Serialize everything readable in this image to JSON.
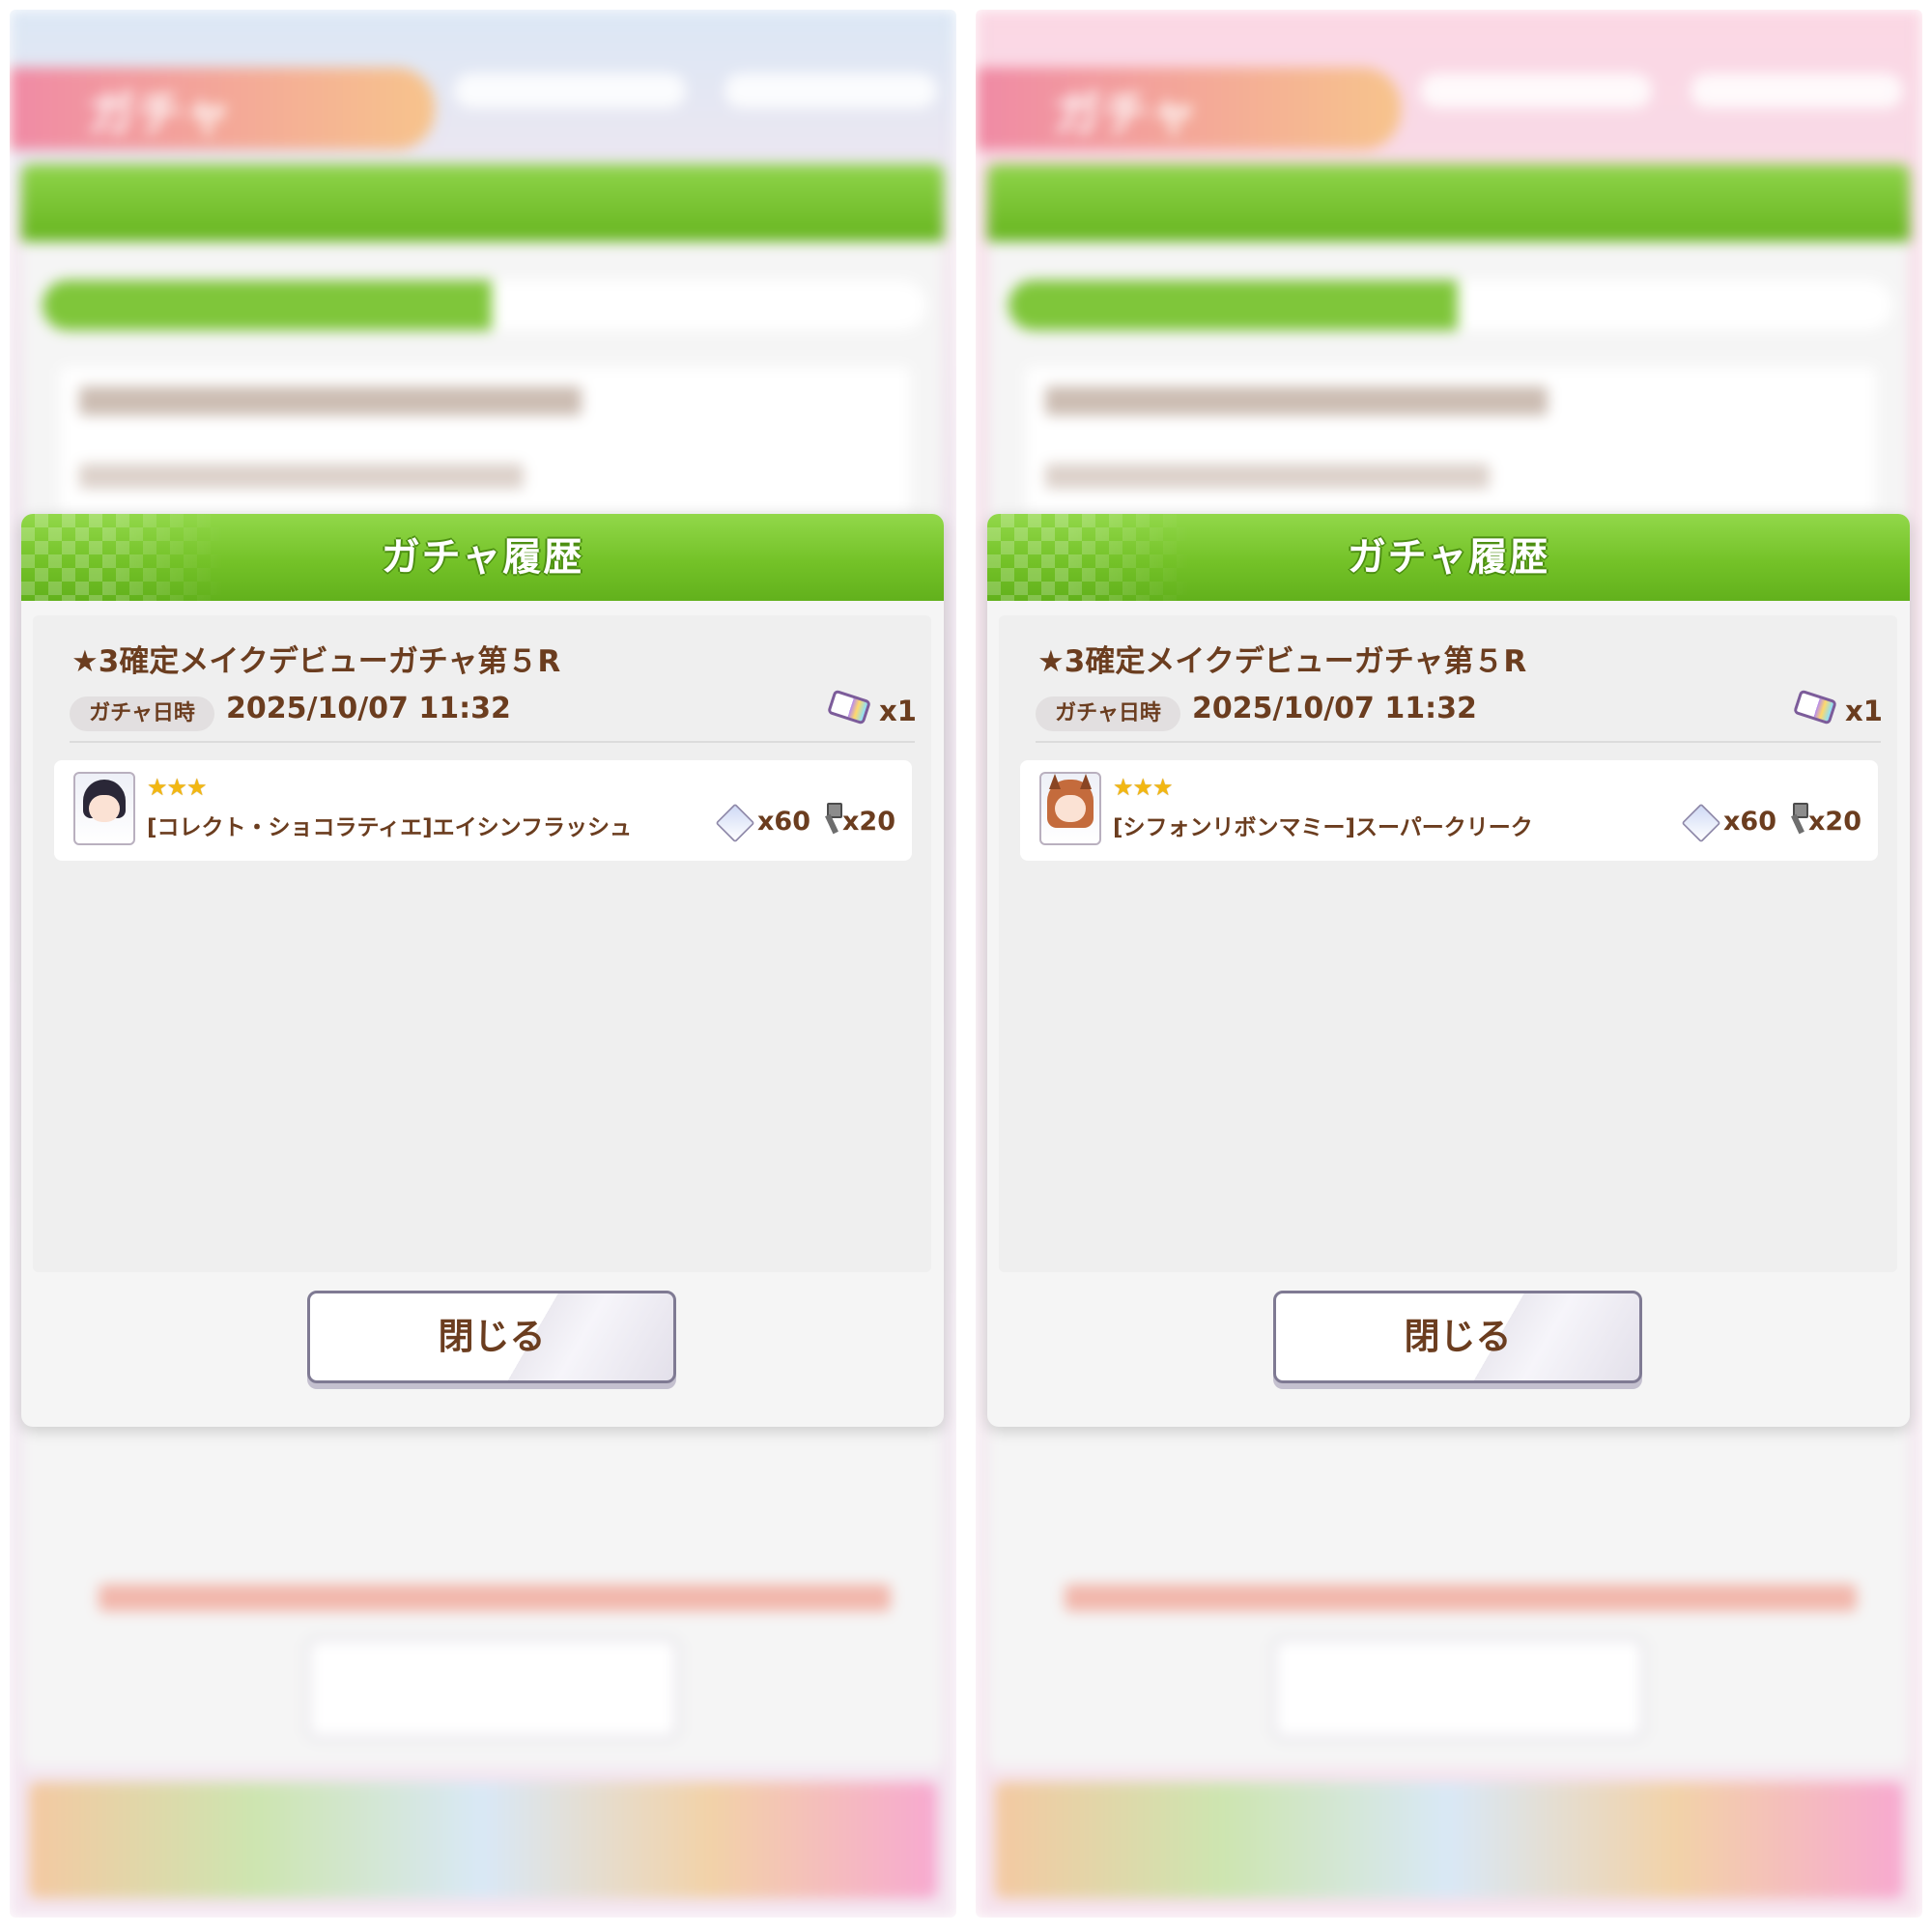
{
  "background": {
    "header_title": "ガチャ",
    "dialog_title": "ガチャ履歴",
    "close_label": "閉じる"
  },
  "panels": [
    {
      "dialog_title": "ガチャ履歴",
      "gacha_name": "★3確定メイクデビューガチャ第５R",
      "date_label": "ガチャ日時",
      "date_value": "2025/10/07 11:32",
      "ticket_count": "x1",
      "result": {
        "rarity": "★★★",
        "name": "[コレクト・ショコラティエ]エイシンフラッシュ",
        "piece_count": "x60",
        "hammer_count": "x20"
      },
      "close_label": "閉じる"
    },
    {
      "dialog_title": "ガチャ履歴",
      "gacha_name": "★3確定メイクデビューガチャ第５R",
      "date_label": "ガチャ日時",
      "date_value": "2025/10/07 11:32",
      "ticket_count": "x1",
      "result": {
        "rarity": "★★★",
        "name": "[シフォンリボンマミー]スーパークリーク",
        "piece_count": "x60",
        "hammer_count": "x20"
      },
      "close_label": "閉じる"
    }
  ],
  "colors": {
    "accent_green": "#74c228",
    "text_brown": "#6b3d1f",
    "star_gold": "#f2b712"
  }
}
